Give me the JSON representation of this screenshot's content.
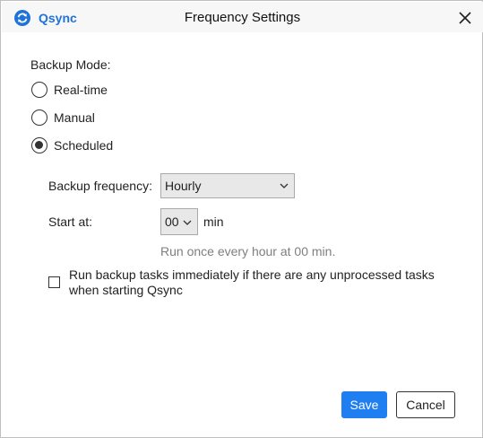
{
  "titlebar": {
    "app_name": "Qsync",
    "title": "Frequency Settings",
    "brand_color": "#1e73d9"
  },
  "backup_mode": {
    "label": "Backup Mode:",
    "options": [
      {
        "label": "Real-time",
        "checked": false
      },
      {
        "label": "Manual",
        "checked": false
      },
      {
        "label": "Scheduled",
        "checked": true
      }
    ]
  },
  "schedule": {
    "frequency_label": "Backup frequency:",
    "frequency_value": "Hourly",
    "start_label": "Start at:",
    "start_value": "00",
    "start_unit": "min",
    "hint": "Run once every hour at 00 min."
  },
  "run_immediately": {
    "checked": false,
    "label": "Run backup tasks immediately if there are any unprocessed tasks when starting Qsync"
  },
  "footer": {
    "save_label": "Save",
    "cancel_label": "Cancel",
    "accent_color": "#1f7ff0"
  },
  "icons": {
    "app_logo": "qsync-sync-icon",
    "close": "close-icon",
    "dropdown": "chevron-down-icon"
  }
}
